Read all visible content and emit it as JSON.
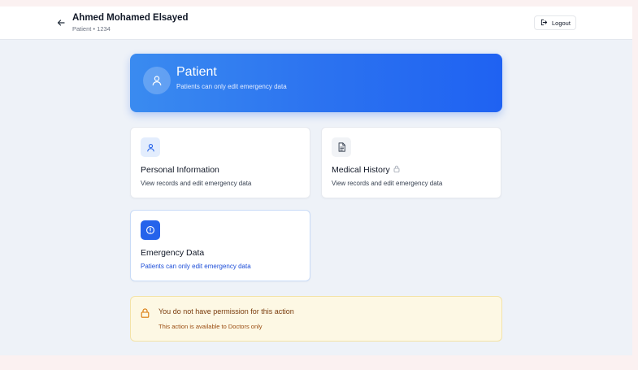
{
  "header": {
    "name": "Ahmed Mohamed Elsayed",
    "subtitle": "Patient • 1234",
    "logout_label": "Logout"
  },
  "hero": {
    "role": "Patient",
    "description": "Patients can only edit emergency data"
  },
  "cards": [
    {
      "title": "Personal Information",
      "description": "View records and edit emergency data",
      "icon": "user-icon"
    },
    {
      "title": "Medical History",
      "description": "View records and edit emergency data",
      "icon": "document-icon",
      "badge_icon": "lock-icon"
    },
    {
      "title": "Emergency Data",
      "description": "Patients can only edit emergency data",
      "icon": "alert-circle-icon"
    }
  ],
  "notice": {
    "title": "You do not have permission for this action",
    "message": "This action is available to Doctors only",
    "icon": "lock-icon"
  },
  "colors": {
    "accent": "#2563eb",
    "warning_bg": "#fdf8e4",
    "warning_text": "#7a3b0c"
  }
}
